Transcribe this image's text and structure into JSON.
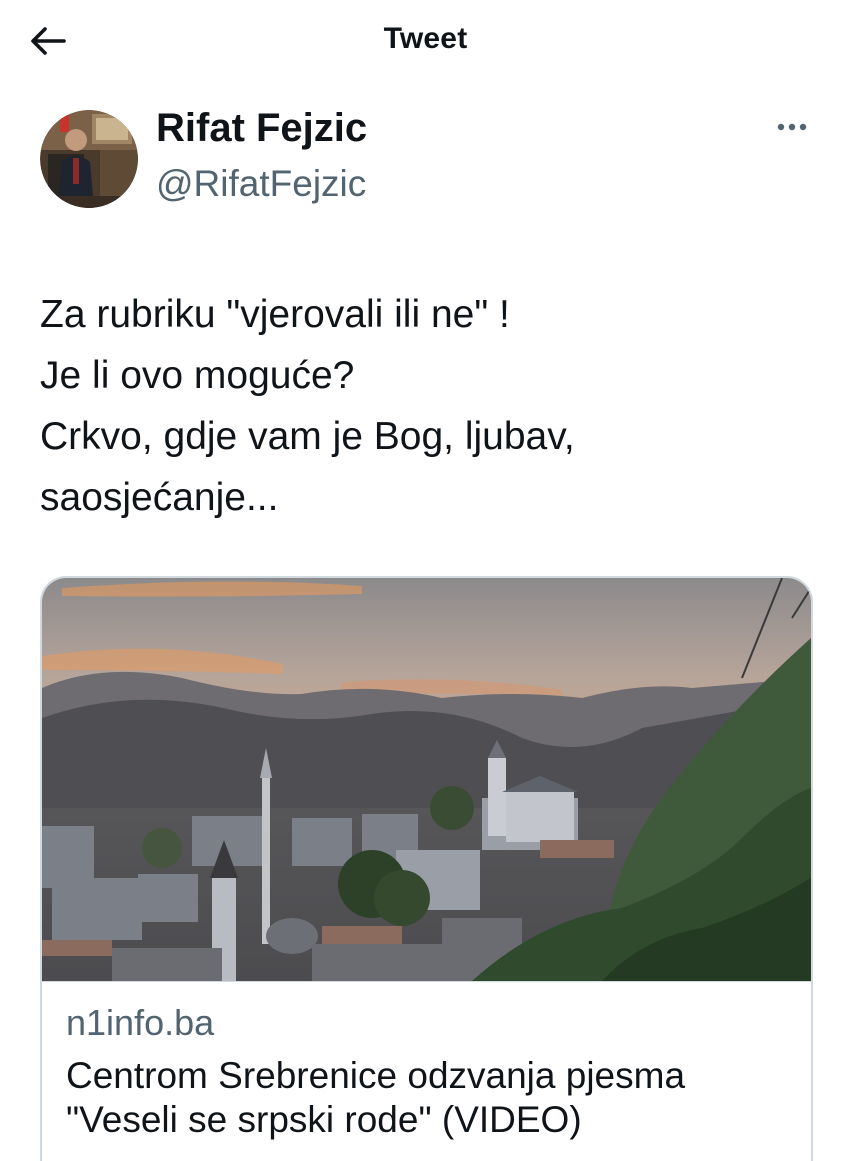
{
  "header": {
    "title": "Tweet",
    "back_icon": "arrow-left-icon"
  },
  "author": {
    "name": "Rifat Fejzic",
    "handle": "@RifatFejzic",
    "more_icon": "more-horizontal-icon"
  },
  "tweet": {
    "lines": [
      "Za rubriku \"vjerovali ili ne\" !",
      "Je li ovo moguće?",
      "Crkvo, gdje vam je Bog, ljubav,",
      "saosjećanje..."
    ]
  },
  "link_card": {
    "domain": "n1info.ba",
    "title": "Centrom Srebrenice odzvanja pjesma \"Veseli se srpski rode\" (VIDEO)"
  },
  "colors": {
    "text_primary": "#0f1419",
    "text_secondary": "#536471",
    "border": "#cfd9de"
  }
}
